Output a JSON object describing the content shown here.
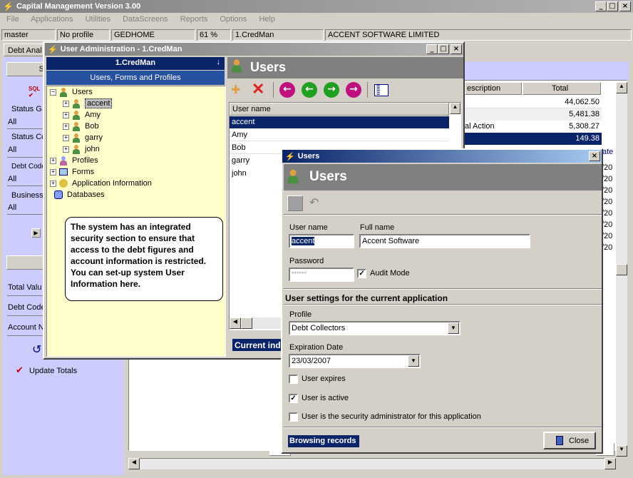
{
  "app": {
    "title": "Capital Management Version 3.00",
    "menu": [
      "File",
      "Applications",
      "Utilities",
      "DataScreens",
      "Reports",
      "Options",
      "Help"
    ],
    "status": [
      "master",
      "No profile",
      "GEDHOME",
      "61 %",
      "1.CredMan",
      "ACCENT SOFTWARE LIMITED"
    ],
    "tab": "Debt Anal"
  },
  "left_panel": {
    "btn_top": "S",
    "items": [
      {
        "label": "Status G",
        "value": "All"
      },
      {
        "label": "Status Co",
        "value": "All"
      },
      {
        "label": "Debt Code",
        "value": "All"
      },
      {
        "label": "Business",
        "value": "All"
      }
    ],
    "lower_labels": [
      "Total Valu",
      "Debt Code",
      "Account N"
    ],
    "update_totals": "Update Totals"
  },
  "bg_grid": {
    "col_description": "escription",
    "col_total": "Total",
    "rows": [
      {
        "desc": "",
        "total": "44,062.50"
      },
      {
        "desc": "",
        "total": "5,481.38"
      },
      {
        "desc": "al Action",
        "total": "5,308.27"
      },
      {
        "desc": "",
        "total": "149.38"
      }
    ],
    "date_header": "ate",
    "date_cells": [
      "/20",
      "/20",
      "/20",
      "/20",
      "/20",
      "/20",
      "/20",
      "/20"
    ]
  },
  "user_admin": {
    "title": "User Administration - 1.CredMan",
    "tree_header": "1.CredMan",
    "tree_subheader": "Users, Forms and Profiles",
    "tree": {
      "users_label": "Users",
      "users": [
        "accent",
        "Amy",
        "Bob",
        "garry",
        "john"
      ],
      "others": [
        "Profiles",
        "Forms",
        "Application Information",
        "Databases"
      ]
    },
    "callout": "The system has an integrated security section to ensure that access to the debt figures and account information is restricted. You can set-up system User Information here.",
    "users_panel_title": "Users",
    "list_header": "User name",
    "list": [
      "accent",
      "Amy",
      "Bob",
      "garry",
      "john"
    ],
    "current_label": "Current inde"
  },
  "users_dialog": {
    "title": "Users",
    "heading": "Users",
    "username_label": "User name",
    "username_value": "accent",
    "fullname_label": "Full name",
    "fullname_value": "Accent Software",
    "password_label": "Password",
    "password_value": "******",
    "audit_label": "Audit Mode",
    "audit_checked": true,
    "settings_heading": "User settings for the current application",
    "profile_label": "Profile",
    "profile_value": "Debt Collectors",
    "expiration_label": "Expiration Date",
    "expiration_value": "23/03/2007",
    "user_expires_label": "User expires",
    "user_expires_checked": false,
    "user_active_label": "User is active",
    "user_active_checked": true,
    "security_admin_label": "User is the security administrator for this application",
    "security_admin_checked": false,
    "browsing_label": "Browsing records",
    "close_label": "Close"
  }
}
